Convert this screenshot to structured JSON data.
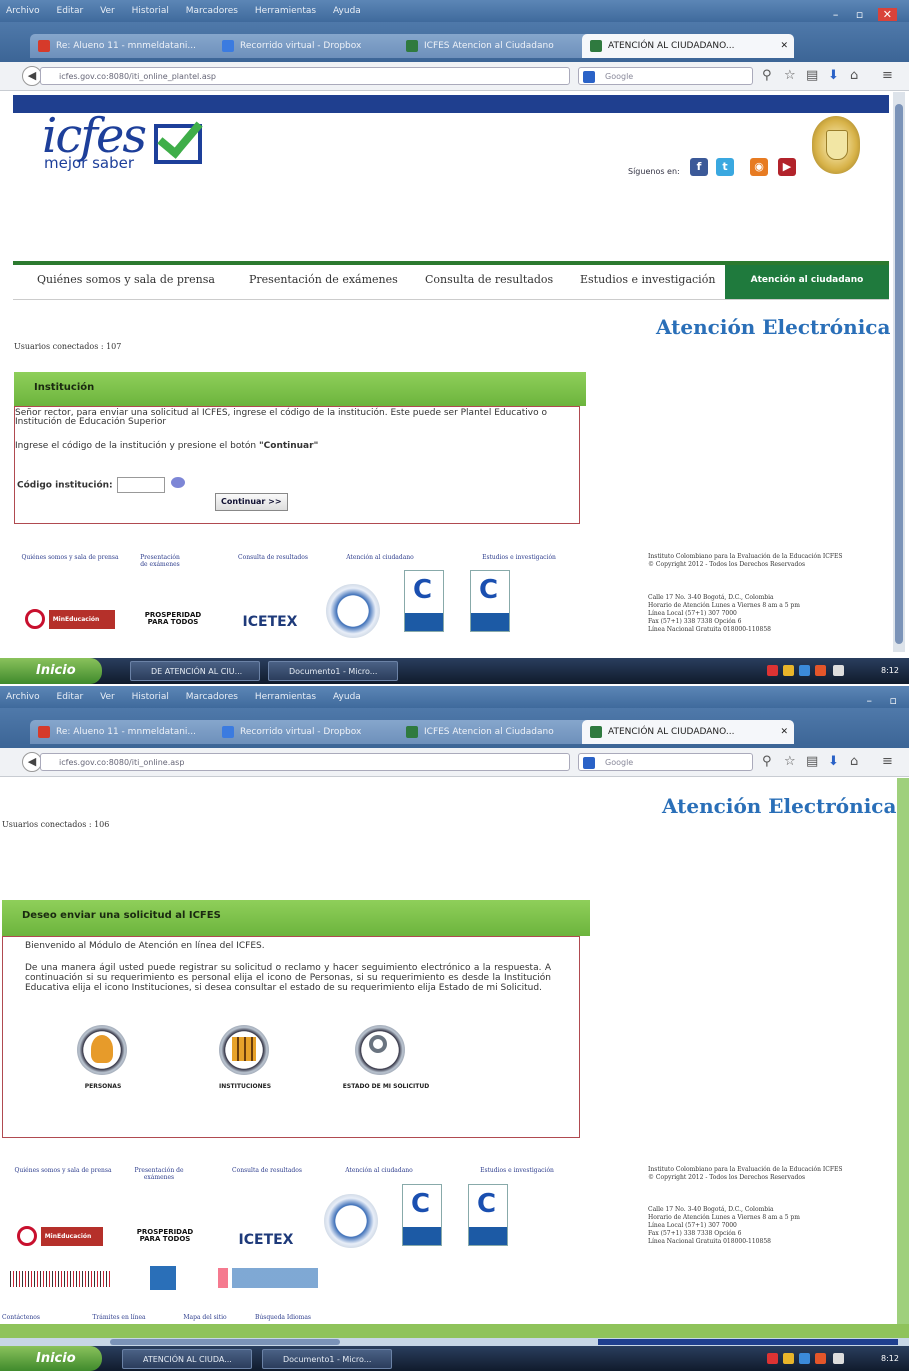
{
  "menu": [
    "Archivo",
    "Editar",
    "Ver",
    "Historial",
    "Marcadores",
    "Herramientas",
    "Ayuda"
  ],
  "tabs": [
    {
      "label": "Re: Alueno 11 - mnmeldatani...",
      "color": "#d63a2a"
    },
    {
      "label": "Recorrido virtual - Dropbox",
      "color": "#3b7be0"
    },
    {
      "label": "ICFES Atencion al Ciudadano",
      "color": "#2f7a3f"
    },
    {
      "label": "ATENCIÓN AL CIUDADANO...",
      "color": "#2f7a3f"
    }
  ],
  "shot1": {
    "url": "icfes.gov.co:8080/iti_online_plantel.asp",
    "search_placeholder": "Google",
    "logo_main": "icfes",
    "logo_sub": "mejor saber",
    "siguenos": "Síguenos en:",
    "nav": [
      "Quiénes somos y sala de prensa",
      "Presentación de exámenes",
      "Consulta de resultados",
      "Estudios e investigación",
      "Atención al ciudadano"
    ],
    "heading": "Atención Electrónica",
    "usuarios": "Usuarios conectados : 107",
    "panel_title": "Institución",
    "panel_text1": "Señor rector, para enviar una solicitud al ICFES, ingrese el código de la institución. Este puede ser Plantel Educativo o Institución de Educación Superior",
    "panel_text2_a": "Ingrese el código de la institución y presione el botón ",
    "panel_text2_b": "\"Continuar\"",
    "codigo_label": "Código institución:",
    "continuar": "Continuar >>",
    "taskbar": [
      "DE ATENCIÓN AL CIU...",
      "Documento1 - Micro..."
    ],
    "clock": "8:12"
  },
  "shot2": {
    "url": "icfes.gov.co:8080/iti_online.asp",
    "search_placeholder": "Google",
    "heading": "Atención Electrónica",
    "usuarios": "Usuarios conectados : 106",
    "panel_title": "Deseo enviar una solicitud al ICFES",
    "welcome": "Bienvenido al Módulo de Atención en línea del ICFES.",
    "body": "De una manera ágil usted puede registrar su solicitud o reclamo y hacer seguimiento electrónico a la respuesta. A continuación si su requerimiento es personal elija el icono de Personas, si su requerimiento es desde la Institución Educativa elija el icono Instituciones, si desea consultar el estado de su requerimiento elija Estado de mi Solicitud.",
    "icons": [
      "PERSONAS",
      "INSTITUCIONES",
      "ESTADO DE MI SOLICITUD"
    ],
    "bottom_links": [
      "Contáctenos",
      "Trámites en línea",
      "Mapa del sitio",
      "Búsqueda Idiomas"
    ],
    "taskbar": [
      "ATENCIÓN AL CIUDA...",
      "Documento1 - Micro..."
    ],
    "clock": "8:12"
  },
  "footer": {
    "links": [
      "Quiénes somos y sala de prensa",
      "Presentación de exámenes",
      "Consulta de resultados",
      "Atención al ciudadano",
      "Estudios e investigación"
    ],
    "info1": "Instituto Colombiano para la Evaluación de la Educación ICFES",
    "info2": "© Copyright 2012 - Todos los Derechos Reservados",
    "addr1": "Calle 17 No. 3-40 Bogotá, D.C., Colombia",
    "addr2": "Horario de Atención Lunes a Viernes 8 am a 5 pm",
    "addr3": "Línea Local (57+1) 307 7000",
    "addr4": "Fax (57+1) 338 7338 Opción 6",
    "addr5": "Línea Nacional Gratuita 018000-110858",
    "mineducacion": "MinEducación",
    "prosperidad": "PROSPERIDAD PARA TODOS",
    "icetex": "ICETEX"
  },
  "start_label": "Inicio",
  "colors": {
    "blue": "#1f3f8f",
    "green": "#1f7a3d",
    "panel_green": "#7cc04a",
    "heading_blue": "#2a6fb8"
  }
}
